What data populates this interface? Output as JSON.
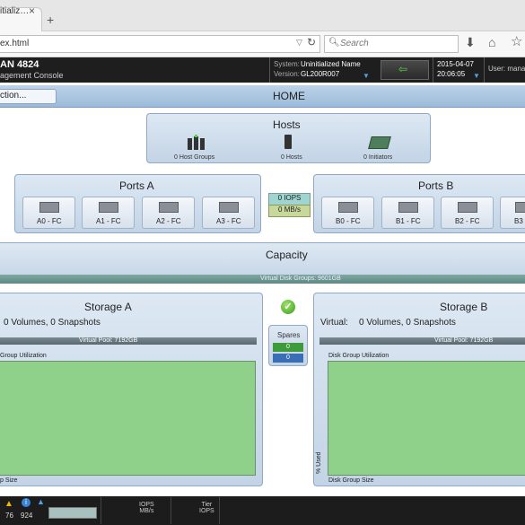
{
  "browser": {
    "tab_title": "itializ…",
    "tab_close": "×",
    "new_tab": "+",
    "url": "ex.html",
    "search_placeholder": "Search"
  },
  "header": {
    "product_name": "AN 4824",
    "product_sub": "agement Console",
    "system_label": "System:",
    "system_value": "Uninitialized Name",
    "version_label": "Version:",
    "version_value": "GL200R007",
    "date": "2015-04-07",
    "time": "20:06:05",
    "user_label": "User: mana"
  },
  "nav": {
    "action_label": "ction...",
    "page_title": "HOME"
  },
  "hosts": {
    "title": "Hosts",
    "host_groups": "0 Host Groups",
    "hosts": "0 Hosts",
    "initiators": "0 Initiators"
  },
  "ports_a": {
    "title": "Ports A",
    "ports": [
      "A0 - FC",
      "A1 - FC",
      "A2 - FC",
      "A3 - FC"
    ]
  },
  "ports_b": {
    "title": "Ports B",
    "ports": [
      "B0 - FC",
      "B1 - FC",
      "B2 - FC",
      "B3"
    ]
  },
  "throughput": {
    "iops": "0 IOPS",
    "mbs": "0 MB/s"
  },
  "capacity": {
    "title": "Capacity",
    "virtual_disk_groups": "Virtual Disk Groups: 9601GB"
  },
  "storage_a": {
    "title": "Storage A",
    "info": "0 Volumes, 0 Snapshots",
    "virtual_pool": "Virtual Pool: 7192GB",
    "utilization_label": "Group Utilization",
    "size_label": "p Size"
  },
  "storage_b": {
    "title": "Storage B",
    "virtual_label": "Virtual:",
    "info": "0 Volumes, 0 Snapshots",
    "virtual_pool": "Virtual Pool: 7192GB",
    "utilization_label": "Disk Group Utilization",
    "size_label": "Disk Group Size",
    "percent_used_label": "% Used"
  },
  "spares": {
    "title": "Spares",
    "value1": "0",
    "value2": "0"
  },
  "status": {
    "warnings": "76",
    "info": "924",
    "iops_label": "IOPS",
    "mbs_label": "MB/s",
    "tier_label": "Tier",
    "tier_iops_label": "IOPS"
  },
  "colors": {
    "header_bg": "#1e1e1e",
    "panel_blue": "#c3d4e6",
    "graph_green": "#8fd18b",
    "iops_teal": "#9ed5d0",
    "mbs_olive": "#c8d79a"
  }
}
